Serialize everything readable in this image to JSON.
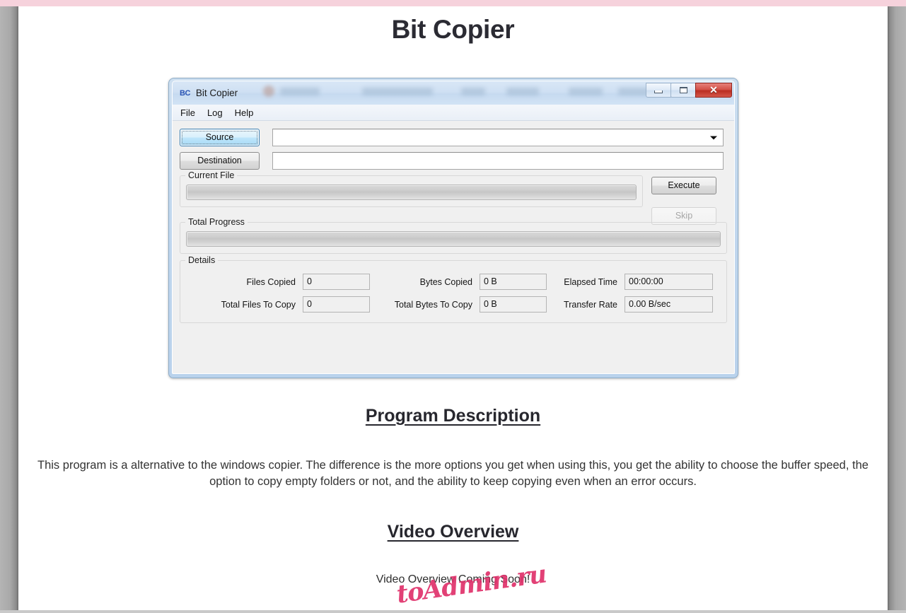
{
  "page": {
    "title": "Bit Copier",
    "watermark": "toAdmin.ru"
  },
  "app_window": {
    "logo": "BC",
    "title": "Bit Copier",
    "window_buttons": {
      "minimize": "minimize-button",
      "maximize": "maximize-button",
      "close": "✕"
    },
    "menu": [
      {
        "label": "File"
      },
      {
        "label": "Log"
      },
      {
        "label": "Help"
      }
    ],
    "source": {
      "button_label": "Source",
      "value": "",
      "placeholder": ""
    },
    "destination": {
      "button_label": "Destination",
      "value": "",
      "placeholder": ""
    },
    "actions": {
      "execute_label": "Execute",
      "skip_label": "Skip"
    },
    "current_file": {
      "group_label": "Current File",
      "progress_percent": 0
    },
    "total_progress": {
      "group_label": "Total Progress",
      "progress_percent": 0
    },
    "details": {
      "group_label": "Details",
      "fields": [
        {
          "label": "Files Copied",
          "value": "0"
        },
        {
          "label": "Bytes Copied",
          "value": "0 B"
        },
        {
          "label": "Elapsed Time",
          "value": "00:00:00"
        },
        {
          "label": "Total Files To Copy",
          "value": "0"
        },
        {
          "label": "Total Bytes To Copy",
          "value": "0 B"
        },
        {
          "label": "Transfer Rate",
          "value": "0.00 B/sec"
        }
      ]
    }
  },
  "description_section": {
    "heading": "Program Description",
    "body": "This program is a alternative to the windows copier. The difference is the more options you get when using this, you get the ability to choose the buffer speed, the option to copy empty folders or not, and the ability to keep copying even when an error occurs."
  },
  "video_section": {
    "heading": "Video Overview",
    "body": "Video Overview Coming Soon!"
  },
  "colors": {
    "accent_blue": "#2a55b5",
    "close_red": "#bb2e22",
    "watermark_pink": "#e0316b",
    "page_text": "#333333"
  }
}
